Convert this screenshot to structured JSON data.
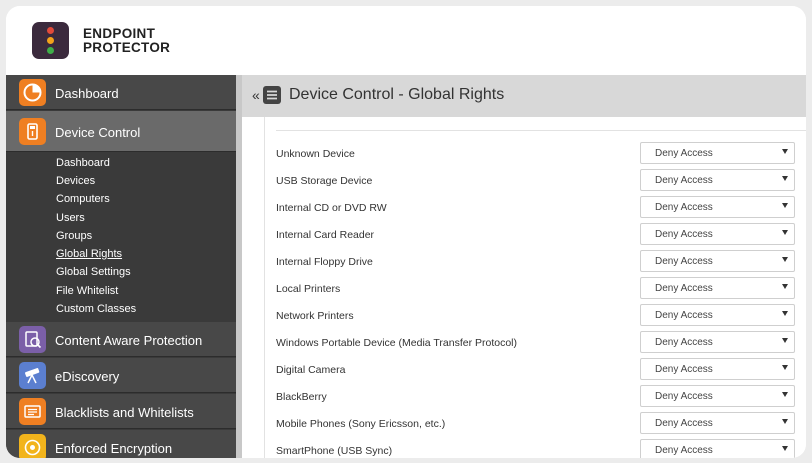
{
  "brand": {
    "line1": "ENDPOINT",
    "line2": "PROTECTOR"
  },
  "sidebar": {
    "items": [
      {
        "label": "Dashboard",
        "icon": "dashboard-icon",
        "color": "#ef7f22"
      },
      {
        "label": "Device Control",
        "icon": "usb-icon",
        "color": "#ef7f22"
      },
      {
        "label": "Content Aware Protection",
        "icon": "content-aware-icon",
        "color": "#7b5fa8"
      },
      {
        "label": "eDiscovery",
        "icon": "telescope-icon",
        "color": "#5b7fd0"
      },
      {
        "label": "Blacklists and Whitelists",
        "icon": "lists-icon",
        "color": "#ef7f22"
      },
      {
        "label": "Enforced Encryption",
        "icon": "encryption-icon",
        "color": "#f2b41c"
      }
    ],
    "submenu": [
      "Dashboard",
      "Devices",
      "Computers",
      "Users",
      "Groups",
      "Global Rights",
      "Global Settings",
      "File Whitelist",
      "Custom Classes"
    ]
  },
  "header": {
    "back": "«",
    "title": "Device Control - Global Rights"
  },
  "devices": [
    {
      "name": "Unknown Device",
      "access": "Deny Access"
    },
    {
      "name": "USB Storage Device",
      "access": "Deny Access"
    },
    {
      "name": "Internal CD or DVD RW",
      "access": "Deny Access"
    },
    {
      "name": "Internal Card Reader",
      "access": "Deny Access"
    },
    {
      "name": "Internal Floppy Drive",
      "access": "Deny Access"
    },
    {
      "name": "Local Printers",
      "access": "Deny Access"
    },
    {
      "name": "Network Printers",
      "access": "Deny Access"
    },
    {
      "name": "Windows Portable Device (Media Transfer Protocol)",
      "access": "Deny Access"
    },
    {
      "name": "Digital Camera",
      "access": "Deny Access"
    },
    {
      "name": "BlackBerry",
      "access": "Deny Access"
    },
    {
      "name": "Mobile Phones (Sony Ericsson, etc.)",
      "access": "Deny Access"
    },
    {
      "name": "SmartPhone (USB Sync)",
      "access": "Deny Access"
    }
  ]
}
